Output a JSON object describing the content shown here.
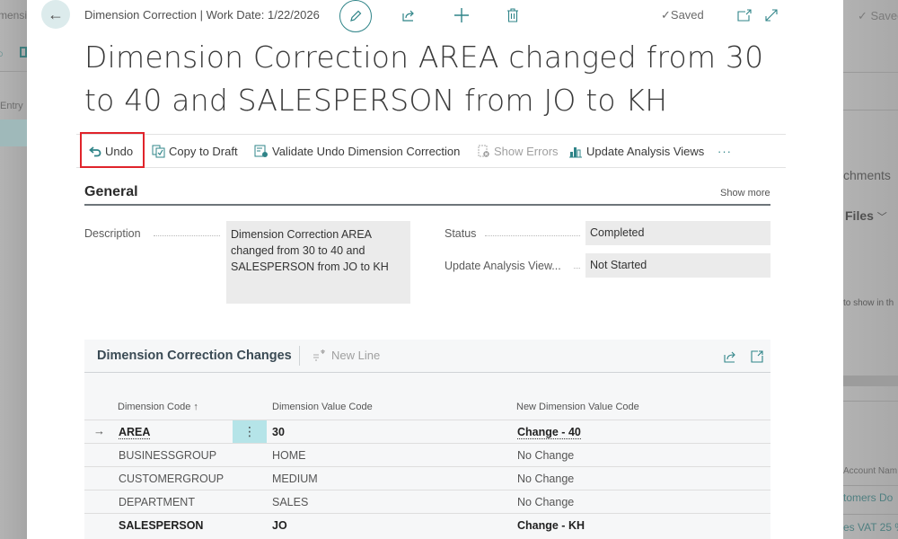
{
  "background": {
    "left_title_fragment": "mensi",
    "left_entry_fragment": "Entry",
    "right_saved": "✓ Saved",
    "right_attachments_fragment": "chments",
    "right_files_fragment": "Files",
    "right_empty_fragment": "to show in th",
    "right_account_header_fragment": "Account Nam",
    "right_row1_fragment": "tomers Do",
    "right_row2_fragment": "es VAT 25 %"
  },
  "header": {
    "breadcrumb": "Dimension Correction | Work Date: 1/22/2026",
    "saved_status": "✓Saved",
    "icons": [
      "back-arrow-icon",
      "pencil-icon",
      "share-icon",
      "plus-icon",
      "trash-icon",
      "open-new-window-icon",
      "expand-icon"
    ]
  },
  "page_title": "Dimension Correction AREA changed from 30 to 40 and SALESPERSON from JO to KH",
  "actions": [
    {
      "label": "Undo",
      "icon": "undo-icon",
      "enabled": true,
      "highlighted": true
    },
    {
      "label": "Copy to Draft",
      "icon": "copy-draft-icon",
      "enabled": true
    },
    {
      "label": "Validate Undo Dimension Correction",
      "icon": "validate-icon",
      "enabled": true
    },
    {
      "label": "Show Errors",
      "icon": "errors-icon",
      "enabled": false
    },
    {
      "label": "Update Analysis Views",
      "icon": "analysis-icon",
      "enabled": true
    },
    {
      "label": "···",
      "icon": "more-icon",
      "enabled": true
    }
  ],
  "general": {
    "title": "General",
    "show_more": "Show more",
    "fields": {
      "description_label": "Description",
      "description_value": "Dimension Correction AREA changed from 30 to 40 and SALESPERSON from JO to KH",
      "status_label": "Status",
      "status_value": "Completed",
      "update_label": "Update Analysis View...",
      "update_value": "Not Started"
    }
  },
  "changes": {
    "title": "Dimension Correction Changes",
    "new_line": "New Line",
    "columns": [
      "Dimension Code ↑",
      "Dimension Value Code",
      "New Dimension Value Code"
    ],
    "rows": [
      {
        "code": "AREA",
        "value": "30",
        "new_value": "Change - 40",
        "bold": true,
        "selected": true
      },
      {
        "code": "BUSINESSGROUP",
        "value": "HOME",
        "new_value": "No Change",
        "bold": false
      },
      {
        "code": "CUSTOMERGROUP",
        "value": "MEDIUM",
        "new_value": "No Change",
        "bold": false
      },
      {
        "code": "DEPARTMENT",
        "value": "SALES",
        "new_value": "No Change",
        "bold": false
      },
      {
        "code": "SALESPERSON",
        "value": "JO",
        "new_value": "Change - KH",
        "bold": true
      }
    ]
  },
  "colors": {
    "accent": "#2f8488",
    "highlight_border": "#e0242b",
    "selected_cell": "#b5e4e8"
  }
}
